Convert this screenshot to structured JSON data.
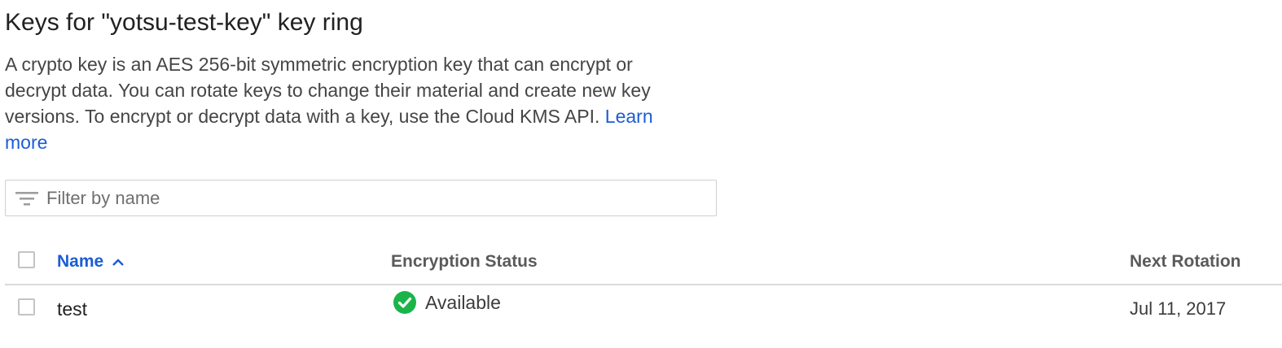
{
  "page": {
    "title": "Keys for \"yotsu-test-key\" key ring",
    "description": "A crypto key is an AES 256-bit symmetric encryption key that can encrypt or decrypt data. You can rotate keys to change their material and create new key versions. To encrypt or decrypt data with a key, use the Cloud KMS API.",
    "learn_more": "Learn more"
  },
  "filter": {
    "placeholder": "Filter by name",
    "value": "",
    "icon": "filter-list-icon"
  },
  "table": {
    "columns": {
      "name": "Name",
      "encryption_status": "Encryption Status",
      "next_rotation": "Next Rotation"
    },
    "sort": {
      "column": "name",
      "direction": "ascending",
      "icon": "chevron-up-icon"
    },
    "rows": [
      {
        "name": "test",
        "encryption_status": "Available",
        "status_icon": "check-circle-icon",
        "next_rotation": "Jul 11, 2017"
      }
    ]
  },
  "colors": {
    "link": "#1a5dd6",
    "status_ok": "#1bb449",
    "divider": "#dadada"
  }
}
